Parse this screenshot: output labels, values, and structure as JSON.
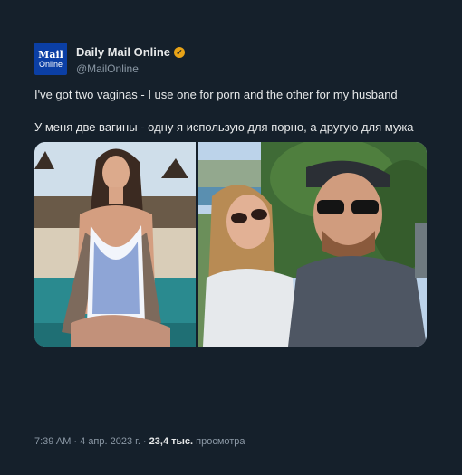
{
  "author": {
    "name": "Daily Mail Online",
    "handle": "@MailOnline",
    "avatar_line1": "Mail",
    "avatar_line2": "Online",
    "verified_icon": "verified-badge-icon"
  },
  "tweet": {
    "text_en": "I've got two vaginas - I use one for porn and the other for my husband",
    "text_ru": "У меня две вагины - одну я использую для порно, а другую для мужа"
  },
  "meta": {
    "time": "7:39 AM",
    "separator1": " · ",
    "date": "4 апр. 2023 г.",
    "separator2": " · ",
    "views_count": "23,4 тыс.",
    "views_label": " просмотра"
  },
  "colors": {
    "background": "#15202b",
    "text": "#e7e9ea",
    "muted": "#8b98a5",
    "avatar_bg": "#0b3fa5",
    "verified": "#e8a317"
  }
}
